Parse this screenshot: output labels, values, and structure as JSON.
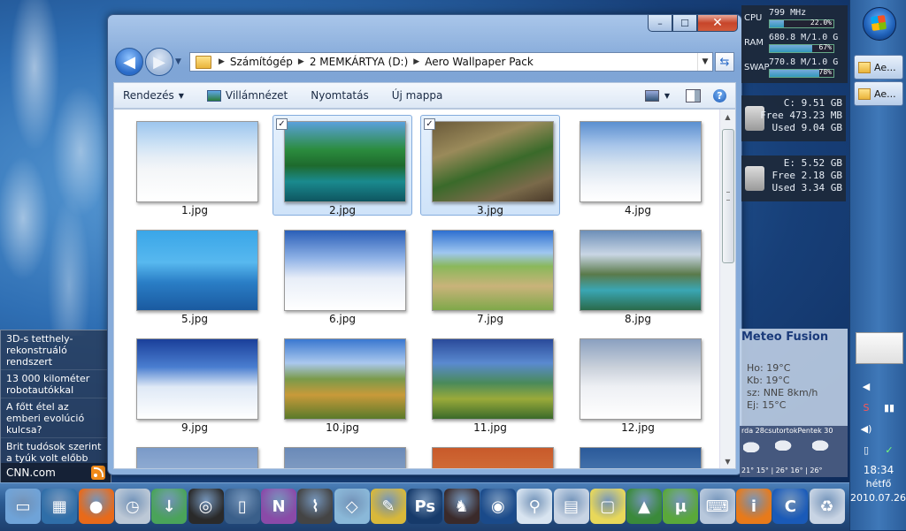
{
  "news": {
    "items": [
      "3D-s tetthely-rekonstruáló rendszert",
      "13 000 kilométer robotautókkal",
      "A főtt étel az emberi evolúció kulcsa?",
      "Brit tudósok szerint a tyúk volt előbb"
    ],
    "source": "CNN.com"
  },
  "window": {
    "caption": {
      "minimize": "–",
      "maximize": "☐",
      "close": "✕"
    },
    "nav": {
      "back": "◀",
      "forward": "▶",
      "dropdown": "▼"
    },
    "address": {
      "crumbs": [
        "Számítógép",
        "2 MEMKÁRTYA (D:)",
        "Aero Wallpaper Pack"
      ],
      "separator": "▶",
      "dropdown": "▼",
      "refresh": "⇆"
    },
    "toolbar": {
      "organize": "Rendezés",
      "slideshow": "Villámnézet",
      "print": "Nyomtatás",
      "new_folder": "Új mappa",
      "arrow": "▼",
      "help": "?"
    },
    "files": [
      {
        "name": "1.jpg",
        "selected": false
      },
      {
        "name": "2.jpg",
        "selected": true
      },
      {
        "name": "3.jpg",
        "selected": true
      },
      {
        "name": "4.jpg",
        "selected": false
      },
      {
        "name": "5.jpg",
        "selected": false
      },
      {
        "name": "6.jpg",
        "selected": false
      },
      {
        "name": "7.jpg",
        "selected": false
      },
      {
        "name": "8.jpg",
        "selected": false
      },
      {
        "name": "9.jpg",
        "selected": false
      },
      {
        "name": "10.jpg",
        "selected": false
      },
      {
        "name": "11.jpg",
        "selected": false
      },
      {
        "name": "12.jpg",
        "selected": false
      },
      {
        "name": "",
        "selected": false
      },
      {
        "name": "",
        "selected": false
      },
      {
        "name": "",
        "selected": false
      },
      {
        "name": "",
        "selected": false
      }
    ],
    "checkmark": "✓",
    "scroll": {
      "up": "▲",
      "down": "▼"
    }
  },
  "sysmon": {
    "cpu": {
      "label": "CPU",
      "value": "799 MHz",
      "percent": "22.0%",
      "fraction": 0.22
    },
    "ram": {
      "label": "RAM",
      "value": "680.8 M/1.0 G",
      "percent": "67%",
      "fraction": 0.67
    },
    "swap": {
      "label": "SWAP",
      "value": "770.8 M/1.0 G",
      "percent": "78%",
      "fraction": 0.78
    }
  },
  "drives": [
    {
      "letter": "C:",
      "size": "9.51 GB",
      "free": "Free 473.23 MB",
      "used": "Used 9.04 GB"
    },
    {
      "letter": "E:",
      "size": "5.52 GB",
      "free": "Free 2.18 GB",
      "used": "Used 3.34 GB"
    }
  ],
  "meteo": {
    "title": "Meteo Fusion",
    "lines": [
      "Ho: 19°C",
      "Kb: 19°C",
      "sz: NNE 8km/h",
      "Ej: 15°C"
    ],
    "days_header": "rda 28csutortokPentek 30",
    "temps": "21° 15° | 26° 16° | 26°"
  },
  "taskbar": {
    "tasks": [
      "Ae...",
      "Ae..."
    ],
    "tray": [
      "◀",
      "S",
      "▮▮",
      "◀)",
      "✓",
      "▯"
    ],
    "clock": {
      "time": "18:34",
      "day": "hétfő",
      "date": "2010.07.26."
    }
  },
  "dock": {
    "icons": [
      {
        "name": "computer",
        "color": "#6fa3d8",
        "glyph": "▭"
      },
      {
        "name": "network",
        "color": "#2f6ea8",
        "glyph": "▦"
      },
      {
        "name": "firefox",
        "color": "#e86a1a",
        "glyph": "●"
      },
      {
        "name": "clock",
        "color": "#bcc8d6",
        "glyph": "◷"
      },
      {
        "name": "download",
        "color": "#4aa35a",
        "glyph": "↓"
      },
      {
        "name": "ubisoft",
        "color": "#2a2a2a",
        "glyph": "◎"
      },
      {
        "name": "book",
        "color": "#3a5f8a",
        "glyph": "▯"
      },
      {
        "name": "onenote",
        "color": "#8a4aa8",
        "glyph": "N"
      },
      {
        "name": "flashlight",
        "color": "#444",
        "glyph": "⌇"
      },
      {
        "name": "glass",
        "color": "#8ab8d8",
        "glyph": "◇"
      },
      {
        "name": "paint",
        "color": "#d8b83a",
        "glyph": "✎"
      },
      {
        "name": "photoshop",
        "color": "#163a6a",
        "glyph": "Ps"
      },
      {
        "name": "horse",
        "color": "#3a2a2a",
        "glyph": "♞"
      },
      {
        "name": "google-earth",
        "color": "#1a4a8a",
        "glyph": "◉"
      },
      {
        "name": "magnifier",
        "color": "#d8e4f0",
        "glyph": "⚲"
      },
      {
        "name": "calculator",
        "color": "#c8d4e4",
        "glyph": "▤"
      },
      {
        "name": "notes",
        "color": "#e8d85a",
        "glyph": "▢"
      },
      {
        "name": "monitor",
        "color": "#3a8a3a",
        "glyph": "▲"
      },
      {
        "name": "utorrent",
        "color": "#5aa83a",
        "glyph": "µ"
      },
      {
        "name": "keyboard",
        "color": "#b8c8dc",
        "glyph": "⌨"
      },
      {
        "name": "info",
        "color": "#e87a1a",
        "glyph": "i"
      },
      {
        "name": "ccleaner",
        "color": "#1a5ab8",
        "glyph": "C"
      },
      {
        "name": "recycle-bin",
        "color": "#c8d4e4",
        "glyph": "♻"
      }
    ]
  }
}
